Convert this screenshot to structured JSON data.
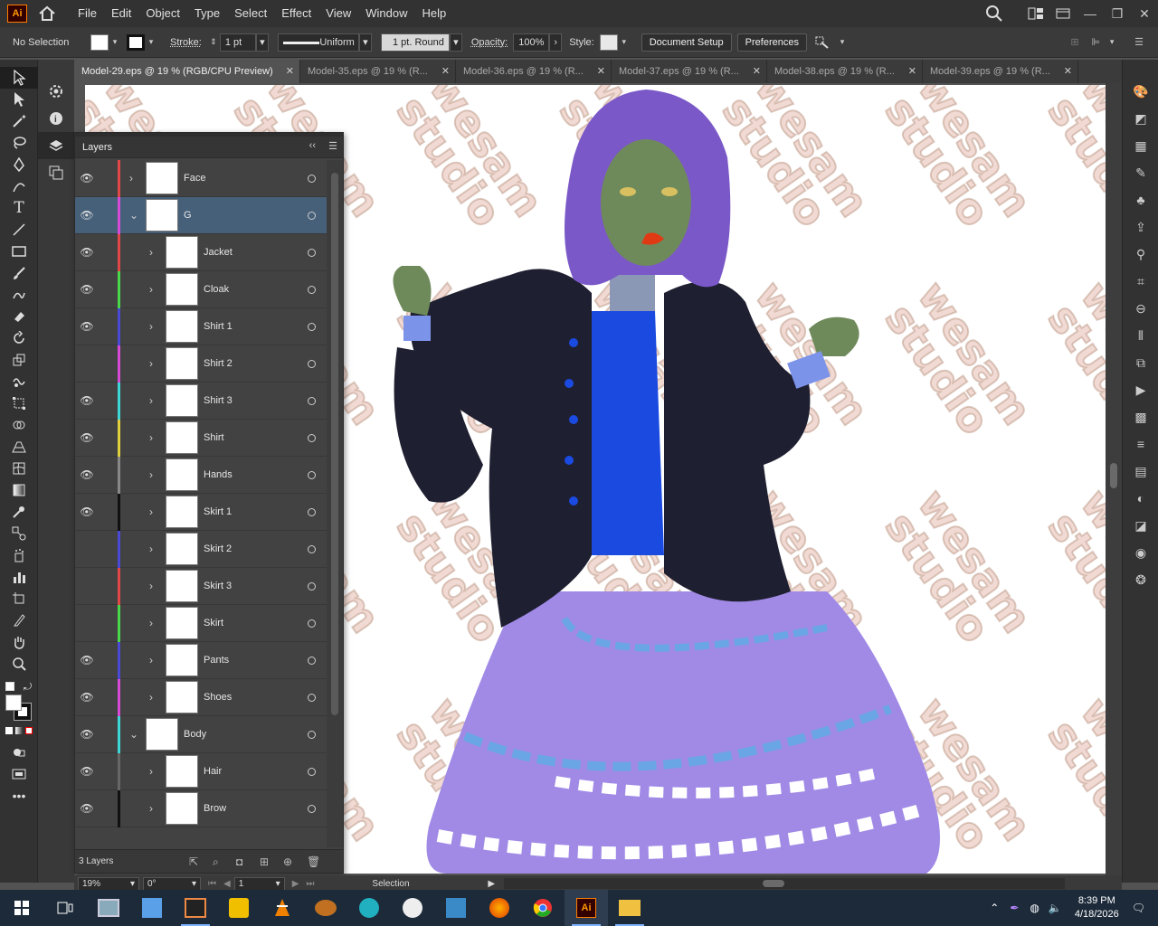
{
  "menubar": {
    "logo": "Ai",
    "items": [
      "File",
      "Edit",
      "Object",
      "Type",
      "Select",
      "Effect",
      "View",
      "Window",
      "Help"
    ]
  },
  "control": {
    "selection_label": "No Selection",
    "stroke_label": "Stroke:",
    "stroke_value": "1 pt",
    "uniform_label": "Uniform",
    "brush_label": "1 pt. Round",
    "opacity_label": "Opacity:",
    "opacity_value": "100%",
    "style_label": "Style:",
    "doc_setup": "Document Setup",
    "preferences": "Preferences"
  },
  "tabs": [
    {
      "label": "Model-29.eps @ 19 % (RGB/CPU Preview)",
      "active": true
    },
    {
      "label": "Model-35.eps @ 19 % (R..."
    },
    {
      "label": "Model-36.eps @ 19 % (R..."
    },
    {
      "label": "Model-37.eps @ 19 % (R..."
    },
    {
      "label": "Model-38.eps @ 19 % (R..."
    },
    {
      "label": "Model-39.eps @ 19 % (R..."
    }
  ],
  "layers_panel": {
    "title": "Layers",
    "footer_count": "3 Layers",
    "rows": [
      {
        "name": "Face",
        "visible": true,
        "color": "#e04848",
        "expanded": false,
        "level": 0,
        "selected": false
      },
      {
        "name": "G",
        "visible": true,
        "color": "#d64bd6",
        "expanded": true,
        "level": 0,
        "selected": true
      },
      {
        "name": "Jacket",
        "visible": true,
        "color": "#e04848",
        "expanded": false,
        "level": 1
      },
      {
        "name": "Cloak",
        "visible": true,
        "color": "#4ad64a",
        "expanded": false,
        "level": 1
      },
      {
        "name": "Shirt 1",
        "visible": true,
        "color": "#4a4ad6",
        "expanded": false,
        "level": 1
      },
      {
        "name": "Shirt 2",
        "visible": false,
        "color": "#d64bd6",
        "expanded": false,
        "level": 1
      },
      {
        "name": "Shirt 3",
        "visible": true,
        "color": "#3ed6d6",
        "expanded": false,
        "level": 1
      },
      {
        "name": "Shirt",
        "visible": true,
        "color": "#e0d040",
        "expanded": false,
        "level": 1
      },
      {
        "name": "Hands",
        "visible": true,
        "color": "#888888",
        "expanded": false,
        "level": 1
      },
      {
        "name": "Skirt 1",
        "visible": true,
        "color": "#111111",
        "expanded": false,
        "level": 1
      },
      {
        "name": "Skirt 2",
        "visible": false,
        "color": "#4a4ad6",
        "expanded": false,
        "level": 1
      },
      {
        "name": "Skirt 3",
        "visible": false,
        "color": "#e04848",
        "expanded": false,
        "level": 1
      },
      {
        "name": "Skirt",
        "visible": false,
        "color": "#4ad64a",
        "expanded": false,
        "level": 1
      },
      {
        "name": "Pants",
        "visible": true,
        "color": "#4a4ad6",
        "expanded": false,
        "level": 1
      },
      {
        "name": "Shoes",
        "visible": true,
        "color": "#d64bd6",
        "expanded": false,
        "level": 1
      },
      {
        "name": "Body",
        "visible": true,
        "color": "#3ed6d6",
        "expanded": true,
        "level": 0
      },
      {
        "name": "Hair",
        "visible": true,
        "color": "#666666",
        "expanded": false,
        "level": 1
      },
      {
        "name": "Brow",
        "visible": true,
        "color": "#111111",
        "expanded": false,
        "level": 1
      }
    ]
  },
  "status": {
    "zoom": "19%",
    "rotation": "0°",
    "artboard": "1",
    "tool": "Selection"
  },
  "watermark": {
    "line1": "wesam",
    "line2": "studio"
  },
  "taskbar": {
    "time": "8:39 PM",
    "date": "4/18/2026"
  }
}
